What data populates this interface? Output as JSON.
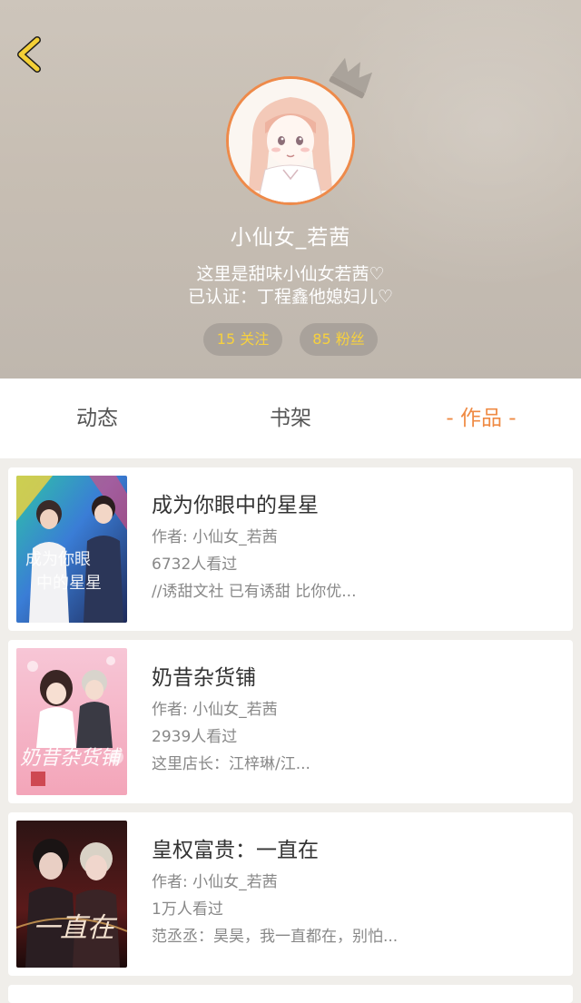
{
  "colors": {
    "accent": "#ef8a43",
    "avatar_border": "#ee8a4a",
    "stat_text": "#f7d13e"
  },
  "header": {
    "back_icon": "chevron-left-icon",
    "nickname": "小仙女_若茜",
    "bio_line1": "这里是甜味小仙女若茜♡",
    "bio_line2": "已认证：丁程鑫他媳妇儿♡",
    "following_label": "15 关注",
    "fans_label": "85 粉丝"
  },
  "tabs": [
    {
      "label": "动态",
      "active": false
    },
    {
      "label": "书架",
      "active": false
    },
    {
      "label": "- 作品 -",
      "active": true
    }
  ],
  "works": [
    {
      "title": "成为你眼中的星星",
      "author": "作者: 小仙女_若茜",
      "views": "6732人看过",
      "desc": "//诱甜文社  已有诱甜  比你优...",
      "cover_text": "成为你眼中的星星"
    },
    {
      "title": "奶昔杂货铺",
      "author": "作者: 小仙女_若茜",
      "views": "2939人看过",
      "desc": "这里店长：江梓琳/江...",
      "cover_text": "奶昔杂货铺"
    },
    {
      "title": "皇权富贵：一直在",
      "author": "作者: 小仙女_若茜",
      "views": "1万人看过",
      "desc": "范丞丞：昊昊，我一直都在，别怕...",
      "cover_text": "一直在"
    }
  ]
}
